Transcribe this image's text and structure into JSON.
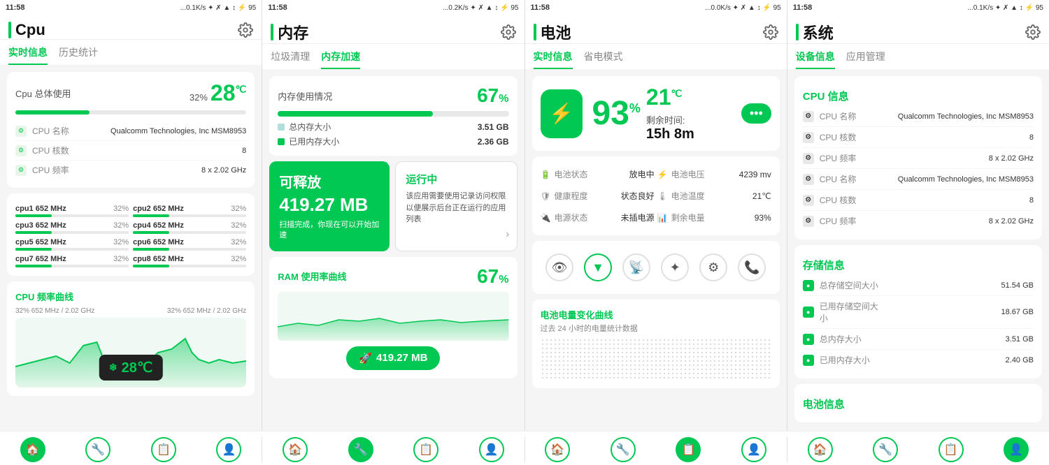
{
  "panels": [
    {
      "id": "cpu",
      "statusLeft": "11:58",
      "statusRight": "...0.1K/s ✦ ✗ ▲ ↕ ⚡ 95",
      "title": "Cpu",
      "tabs": [
        "实时信息",
        "历史统计"
      ],
      "activeTab": 0,
      "cpuUsage": {
        "label": "Cpu 总体使用",
        "percent": "32%",
        "fillWidth": "32",
        "temp": "28",
        "unit": "℃"
      },
      "cpuInfo": [
        {
          "key": "CPU 名称",
          "val": "Qualcomm Technologies, Inc MSM8953"
        },
        {
          "key": "CPU 核数",
          "val": "8"
        },
        {
          "key": "CPU 频率",
          "val": "8 x 2.02 GHz"
        }
      ],
      "cores": [
        {
          "name": "cpu1",
          "freq": "652 MHz",
          "pct": "32%",
          "fill": 32
        },
        {
          "name": "cpu2",
          "freq": "652 MHz",
          "pct": "32%",
          "fill": 32
        },
        {
          "name": "cpu3",
          "freq": "652 MHz",
          "pct": "32%",
          "fill": 32
        },
        {
          "name": "cpu4",
          "freq": "652 MHz",
          "pct": "32%",
          "fill": 32
        },
        {
          "name": "cpu5",
          "freq": "652 MHz",
          "pct": "32%",
          "fill": 32
        },
        {
          "name": "cpu6",
          "freq": "652 MHz",
          "pct": "32%",
          "fill": 32
        },
        {
          "name": "cpu7",
          "freq": "652 MHz",
          "pct": "32%",
          "fill": 32
        },
        {
          "name": "cpu8",
          "freq": "652 MHz",
          "pct": "32%",
          "fill": 32
        }
      ],
      "chartTitle": "CPU 频率曲线",
      "chartLabels": [
        "32%  652 MHz / 2.02 GHz",
        "32%  652 MHz / 2.02 GHz"
      ],
      "tempBadge": "28℃"
    },
    {
      "id": "memory",
      "statusLeft": "11:58",
      "statusRight": "...0.2K/s ✦ ✗ ▲ ↕ ⚡ 95",
      "title": "内存",
      "tabs": [
        "垃圾清理",
        "内存加速"
      ],
      "activeTab": 1,
      "memUsage": {
        "label": "内存使用情况",
        "percent": "67",
        "fillWidth": 67
      },
      "memLegend": [
        {
          "color": "#b2dfdb",
          "label": "总内存大小",
          "val": "3.51 GB"
        },
        {
          "color": "#00c853",
          "label": "已用内存大小",
          "val": "2.36 GB"
        }
      ],
      "releaseCard": {
        "title": "可释放",
        "value": "419.27 MB",
        "desc": "扫描完成，你现在可以开始加速"
      },
      "runningCard": {
        "title": "运行中",
        "desc": "该应用需要使用记录访问权限以便展示后台正在运行的应用列表"
      },
      "ramCurve": {
        "label": "RAM 使用率曲线",
        "percent": "67",
        "badgeVal": "419.27 MB"
      }
    },
    {
      "id": "battery",
      "statusLeft": "11:58",
      "statusRight": "...0.0K/s ✦ ✗ ▲ ↕ ⚡ 95",
      "title": "电池",
      "tabs": [
        "实时信息",
        "省电模式"
      ],
      "activeTab": 0,
      "batteryMain": {
        "percent": "93",
        "temp": "21",
        "unit": "℃",
        "timeLabel": "剩余时间:",
        "timeVal": "15h 8m"
      },
      "batteryStats": [
        {
          "key": "电池状态",
          "val": "放电中"
        },
        {
          "key": "健康程度",
          "val": "状态良好"
        },
        {
          "key": "电源状态",
          "val": "未插电源"
        },
        {
          "key": "电池电压",
          "val": "4239 mv"
        },
        {
          "key": "电池温度",
          "val": "21℃"
        },
        {
          "key": "剩余电量",
          "val": "93%"
        }
      ],
      "toggles": [
        "👁",
        "▼",
        "📡",
        "✦",
        "⚙",
        "📞"
      ],
      "curveTitle": "电池电量变化曲线",
      "curveSub": "过去 24 小时的电量统计数据"
    },
    {
      "id": "system",
      "statusLeft": "11:58",
      "statusRight": "...0.1K/s ✦ ✗ ▲ ↕ ⚡ 95",
      "title": "系统",
      "tabs": [
        "设备信息",
        "应用管理"
      ],
      "activeTab": 0,
      "cpuInfoSection": {
        "title": "CPU 信息",
        "rows": [
          {
            "key": "CPU 名称",
            "val": "Qualcomm Technologies, Inc MSM8953"
          },
          {
            "key": "CPU 核数",
            "val": "8"
          },
          {
            "key": "CPU 频率",
            "val": "8 x 2.02 GHz"
          },
          {
            "key": "CPU 名称",
            "val": "Qualcomm Technologies, Inc MSM8953"
          },
          {
            "key": "CPU 核数",
            "val": "8"
          },
          {
            "key": "CPU 频率",
            "val": "8 x 2.02 GHz"
          }
        ]
      },
      "storageSection": {
        "title": "存储信息",
        "rows": [
          {
            "key": "总存储空间大小",
            "val": "51.54 GB"
          },
          {
            "key": "已用存储空间大小",
            "val": "18.67 GB"
          },
          {
            "key": "总内存大小",
            "val": "3.51 GB"
          },
          {
            "key": "已用内存大小",
            "val": "2.40 GB"
          }
        ]
      },
      "batterySection": {
        "title": "电池信息"
      }
    }
  ],
  "bottomNav": {
    "icons": [
      "🏠",
      "🔧",
      "📋",
      "👤"
    ]
  }
}
